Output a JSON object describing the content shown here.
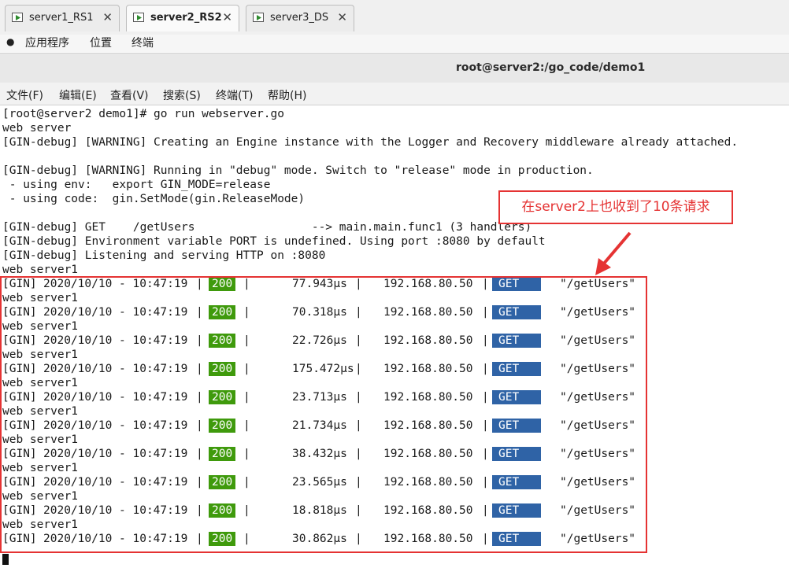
{
  "tabs": [
    {
      "label": "server1_RS1",
      "active": false
    },
    {
      "label": "server2_RS2",
      "active": true
    },
    {
      "label": "server3_DS",
      "active": false
    }
  ],
  "gnome_menu": {
    "apps": "应用程序",
    "places": "位置",
    "terminal": "终端"
  },
  "window_title": "root@server2:/go_code/demo1",
  "app_menu": [
    "文件(F)",
    "编辑(E)",
    "查看(V)",
    "搜索(S)",
    "终端(T)",
    "帮助(H)"
  ],
  "terminal": {
    "preamble": [
      "[root@server2 demo1]# go run webserver.go",
      "web server",
      "[GIN-debug] [WARNING] Creating an Engine instance with the Logger and Recovery middleware already attached.",
      "",
      "[GIN-debug] [WARNING] Running in \"debug\" mode. Switch to \"release\" mode in production.",
      " - using env:   export GIN_MODE=release",
      " - using code:  gin.SetMode(gin.ReleaseMode)",
      "",
      "[GIN-debug] GET    /getUsers                 --> main.main.func1 (3 handlers)",
      "[GIN-debug] Environment variable PORT is undefined. Using port :8080 by default",
      "[GIN-debug] Listening and serving HTTP on :8080",
      "web server1"
    ],
    "requests": [
      {
        "prefix": "[GIN]",
        "timestamp": "2020/10/10 - 10:47:19",
        "status": "200",
        "latency": "77.943µs",
        "ip": "192.168.80.50",
        "method": "GET",
        "path": "\"/getUsers\""
      },
      {
        "prefix": "[GIN]",
        "timestamp": "2020/10/10 - 10:47:19",
        "status": "200",
        "latency": "70.318µs",
        "ip": "192.168.80.50",
        "method": "GET",
        "path": "\"/getUsers\""
      },
      {
        "prefix": "[GIN]",
        "timestamp": "2020/10/10 - 10:47:19",
        "status": "200",
        "latency": "22.726µs",
        "ip": "192.168.80.50",
        "method": "GET",
        "path": "\"/getUsers\""
      },
      {
        "prefix": "[GIN]",
        "timestamp": "2020/10/10 - 10:47:19",
        "status": "200",
        "latency": "175.472µs",
        "ip": "192.168.80.50",
        "method": "GET",
        "path": "\"/getUsers\""
      },
      {
        "prefix": "[GIN]",
        "timestamp": "2020/10/10 - 10:47:19",
        "status": "200",
        "latency": "23.713µs",
        "ip": "192.168.80.50",
        "method": "GET",
        "path": "\"/getUsers\""
      },
      {
        "prefix": "[GIN]",
        "timestamp": "2020/10/10 - 10:47:19",
        "status": "200",
        "latency": "21.734µs",
        "ip": "192.168.80.50",
        "method": "GET",
        "path": "\"/getUsers\""
      },
      {
        "prefix": "[GIN]",
        "timestamp": "2020/10/10 - 10:47:19",
        "status": "200",
        "latency": "38.432µs",
        "ip": "192.168.80.50",
        "method": "GET",
        "path": "\"/getUsers\""
      },
      {
        "prefix": "[GIN]",
        "timestamp": "2020/10/10 - 10:47:19",
        "status": "200",
        "latency": "23.565µs",
        "ip": "192.168.80.50",
        "method": "GET",
        "path": "\"/getUsers\""
      },
      {
        "prefix": "[GIN]",
        "timestamp": "2020/10/10 - 10:47:19",
        "status": "200",
        "latency": "18.818µs",
        "ip": "192.168.80.50",
        "method": "GET",
        "path": "\"/getUsers\""
      },
      {
        "prefix": "[GIN]",
        "timestamp": "2020/10/10 - 10:47:19",
        "status": "200",
        "latency": "30.862µs",
        "ip": "192.168.80.50",
        "method": "GET",
        "path": "\"/getUsers\""
      }
    ],
    "between_line": "web server1"
  },
  "annotation": {
    "text": "在server2上也收到了10条请求",
    "color": "#e53333"
  },
  "colors": {
    "status_bg": "#3f9a0c",
    "method_bg": "#2f63a6"
  }
}
